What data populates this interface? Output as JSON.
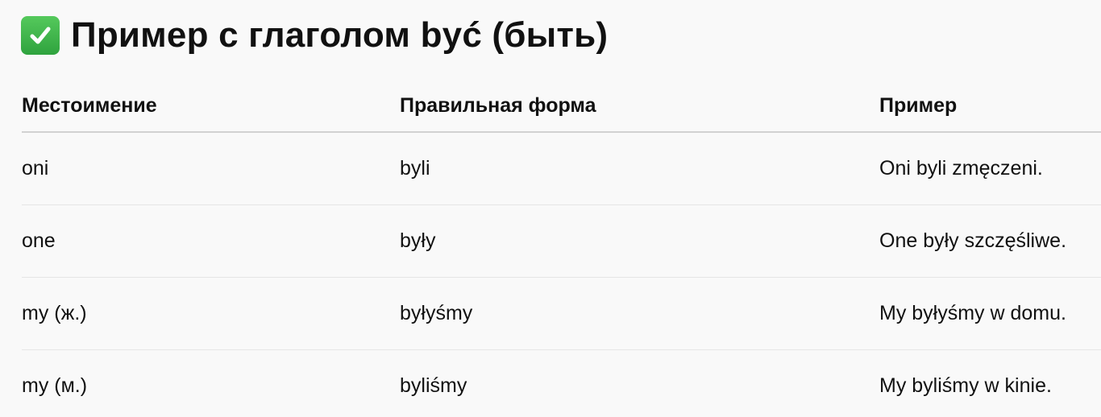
{
  "heading": {
    "icon": "check-mark-button-icon",
    "icon_color": "#3dbb4b",
    "text": "Пример с глаголом być (быть)"
  },
  "table": {
    "headers": [
      "Местоимение",
      "Правильная форма",
      "Пример"
    ],
    "rows": [
      [
        "oni",
        "byli",
        "Oni byli zmęczeni."
      ],
      [
        "one",
        "były",
        "One były szczęśliwe."
      ],
      [
        "my (ж.)",
        "byłyśmy",
        "My byłyśmy w domu."
      ],
      [
        "my (м.)",
        "byliśmy",
        "My byliśmy w kinie."
      ]
    ]
  }
}
